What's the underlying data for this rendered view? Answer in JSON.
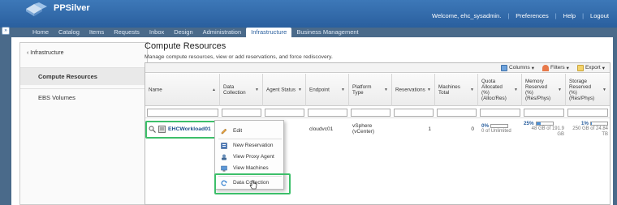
{
  "header": {
    "app_title": "PPSilver",
    "welcome": "Welcome, ehc_sysadmin.",
    "preferences": "Preferences",
    "help": "Help",
    "logout": "Logout",
    "collapse": "»"
  },
  "nav": {
    "tabs": [
      "Home",
      "Catalog",
      "Items",
      "Requests",
      "Inbox",
      "Design",
      "Administration",
      "Infrastructure",
      "Business Management"
    ],
    "active": "Infrastructure"
  },
  "sidebar": {
    "breadcrumb": "‹ Infrastructure",
    "items": [
      {
        "label": "Compute Resources",
        "selected": true
      },
      {
        "label": "EBS Volumes",
        "selected": false
      }
    ]
  },
  "content": {
    "title": "Compute Resources",
    "subtitle": "Manage compute resources, view or add reservations, and force rediscovery."
  },
  "toolbar": {
    "columns": "Columns",
    "filters": "Filters",
    "export": "Export"
  },
  "table": {
    "columns": [
      "Name",
      "Data Collection",
      "Agent Status",
      "Endpoint",
      "Platform Type",
      "Reservations",
      "Machines Total",
      "Quota Allocated (%) (Alloc/Res)",
      "Memory Reserved (%) (Res/Phys)",
      "Storage Reserved (%) (Res/Phys)"
    ],
    "row": {
      "name": "EHCWorkload01",
      "endpoint": "cloudvc01",
      "platform_line1": "vSphere",
      "platform_line2": "(vCenter)",
      "reservations": "1",
      "machines_total": "0",
      "quota_pct": "0%",
      "quota_pct_value": 0,
      "quota_sub": "0 of Unlimited",
      "memory_pct": "25%",
      "memory_pct_value": 25,
      "memory_sub": "48 GB of 191.9 GB",
      "storage_pct": "1%",
      "storage_pct_value": 1,
      "storage_sub": "250 GB of 24.84 TB"
    }
  },
  "context_menu": {
    "items": [
      "Edit",
      "New Reservation",
      "View Proxy Agent",
      "View Machines",
      "Data Collection"
    ]
  },
  "colors": {
    "brand": "#2a5f9e",
    "highlight": "#3dbf6a"
  }
}
